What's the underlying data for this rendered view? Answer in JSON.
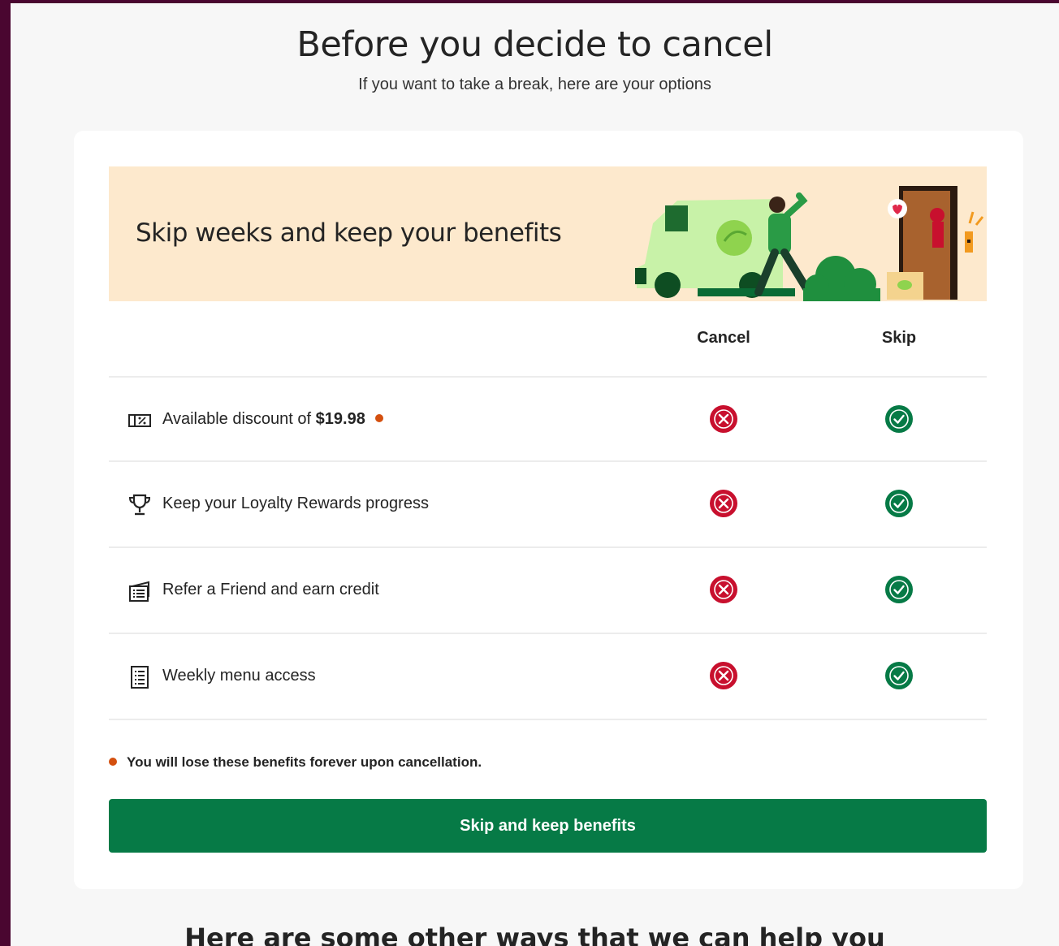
{
  "header": {
    "title": "Before you decide to cancel",
    "subtitle": "If you want to take a break, here are your options"
  },
  "banner": {
    "title": "Skip weeks and keep your benefits"
  },
  "table": {
    "columns": [
      "Cancel",
      "Skip"
    ],
    "rows": [
      {
        "icon": "ticket-discount-icon",
        "label": "Available discount of ",
        "bold": "$19.98",
        "warning_dot": true,
        "cancel": "no",
        "skip": "yes"
      },
      {
        "icon": "trophy-icon",
        "label": "Keep your Loyalty Rewards progress",
        "bold": "",
        "warning_dot": false,
        "cancel": "no",
        "skip": "yes"
      },
      {
        "icon": "gift-card-icon",
        "label": "Refer a Friend and earn credit",
        "bold": "",
        "warning_dot": false,
        "cancel": "no",
        "skip": "yes"
      },
      {
        "icon": "menu-list-icon",
        "label": "Weekly menu access",
        "bold": "",
        "warning_dot": false,
        "cancel": "no",
        "skip": "yes"
      }
    ]
  },
  "note": "You will lose these benefits forever upon cancellation.",
  "cta_label": "Skip and keep benefits",
  "footer_heading": "Here are some other ways that we can help you",
  "colors": {
    "brand_green": "#067a46",
    "cancel_red": "#c8102e",
    "warning_orange": "#d4500f",
    "banner_bg": "#fde9cd",
    "frame": "#4a0630"
  }
}
